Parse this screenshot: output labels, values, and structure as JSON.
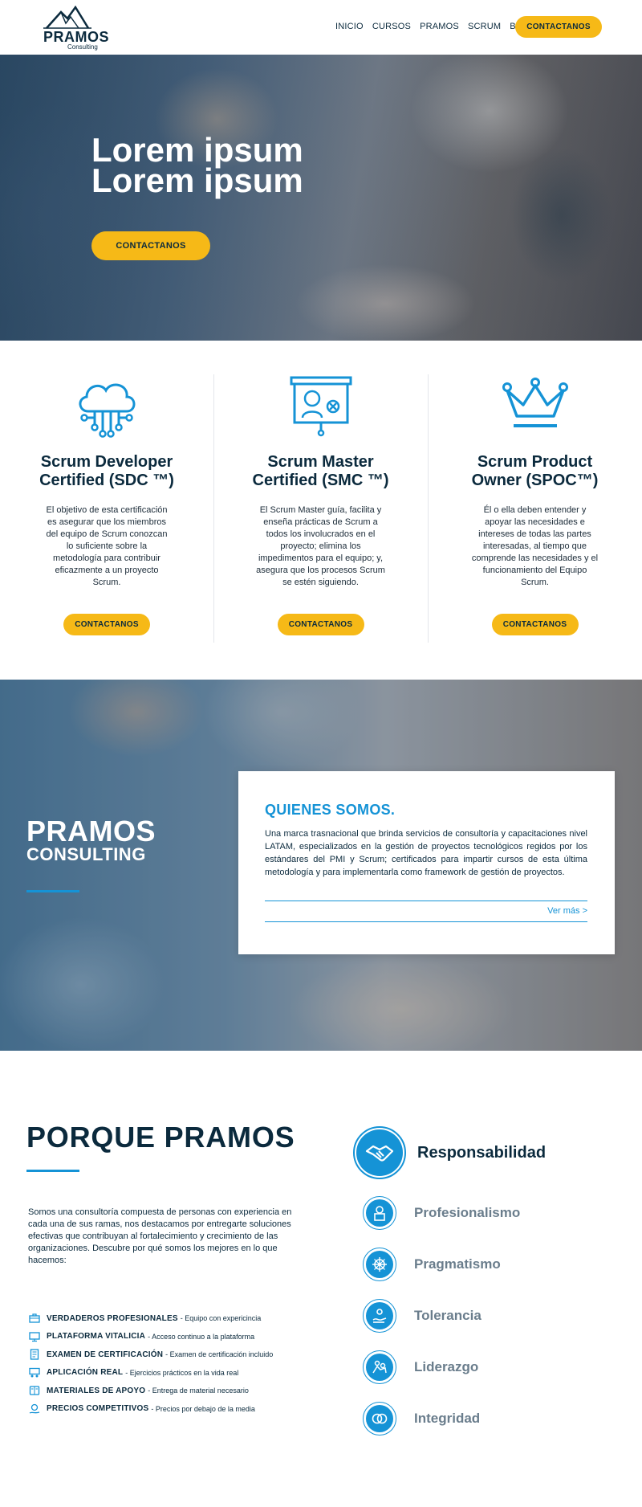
{
  "nav": {
    "logo": {
      "name": "PRAMOS",
      "sub": "Consulting"
    },
    "items": [
      {
        "label": "INICIO"
      },
      {
        "label": "CURSOS"
      },
      {
        "label": "PRAMOS"
      },
      {
        "label": "SCRUM"
      },
      {
        "label": "BLOG"
      }
    ],
    "cta": "CONTACTANOS"
  },
  "hero": {
    "title_line1": "Lorem ipsum",
    "title_line2": "Lorem ipsum",
    "cta": "CONTACTANOS"
  },
  "certs": [
    {
      "icon": "cloud-network-icon",
      "title_line1": "Scrum Developer",
      "title_line2": "Certified (SDC ™)",
      "description": "El objetivo de esta certificación es asegurar que los miembros del equipo de Scrum conozcan lo suficiente sobre la metodología para contribuir eficazmente a un proyecto Scrum.",
      "cta": "CONTACTANOS"
    },
    {
      "icon": "presentation-board-icon",
      "title_line1": "Scrum Master",
      "title_line2": "Certified (SMC ™)",
      "description": "El Scrum Master guía, facilita y enseña prácticas de Scrum a todos los involucrados en el proyecto; elimina los impedimentos para el equipo; y, asegura que los procesos Scrum se estén siguiendo.",
      "cta": "CONTACTANOS"
    },
    {
      "icon": "crown-icon",
      "title_line1": "Scrum Product",
      "title_line2": "Owner (SPOC™)",
      "description": "Él o ella deben entender y apoyar las necesidades e intereses de todas las partes interesadas, al tiempo que comprende las necesidades y el funcionamiento del Equipo Scrum.",
      "cta": "CONTACTANOS"
    }
  ],
  "about": {
    "brand_line1": "PRAMOS",
    "brand_line2": "CONSULTING",
    "heading": "QUIENES SOMOS.",
    "paragraph": "Una marca trasnacional que brinda servicios de consultoría y capacitaciones nivel LATAM, especializados en la gestión de proyectos tecnológicos regidos por los estándares del PMI y Scrum; certificados para impartir cursos de esta última metodología y para implementarla como framework de gestión de proyectos.",
    "more": "Ver más >"
  },
  "why": {
    "title": "PORQUE PRAMOS",
    "paragraph": "Somos una consultoría compuesta de personas con experiencia en cada una de sus ramas, nos destacamos por entregarte soluciones efectivas que contribuyan al fortalecimiento y crecimiento de las organizaciones. Descubre por qué somos los mejores en lo que hacemos:",
    "features": [
      {
        "icon": "briefcase-icon",
        "bold": "VERDADEROS PROFESIONALES",
        "text": "- Equipo con expericincia"
      },
      {
        "icon": "monitor-icon",
        "bold": "PLATAFORMA VITALICIA",
        "text": "- Acceso continuo a la plataforma"
      },
      {
        "icon": "document-icon",
        "bold": "EXAMEN DE CERTIFICACIÓN",
        "text": "- Examen de certificación incluido"
      },
      {
        "icon": "classroom-icon",
        "bold": "APLICACIÓN REAL",
        "text": "- Ejercicios prácticos en la vida real"
      },
      {
        "icon": "books-icon",
        "bold": "MATERIALES DE APOYO",
        "text": "- Entrega de material necesario"
      },
      {
        "icon": "money-hand-icon",
        "bold": "PRECIOS COMPETITIVOS",
        "text": "- Precios por debajo de la media"
      }
    ],
    "values": [
      {
        "icon": "handshake-icon",
        "label": "Responsabilidad"
      },
      {
        "icon": "professional-icon",
        "label": "Profesionalismo"
      },
      {
        "icon": "ship-wheel-icon",
        "label": "Pragmatismo"
      },
      {
        "icon": "hand-person-icon",
        "label": "Tolerancia"
      },
      {
        "icon": "leadership-icon",
        "label": "Liderazgo"
      },
      {
        "icon": "rings-icon",
        "label": "Integridad"
      }
    ]
  },
  "colors": {
    "accent": "#f6b917",
    "blue": "#1593d6",
    "navy": "#0b2a3d"
  }
}
